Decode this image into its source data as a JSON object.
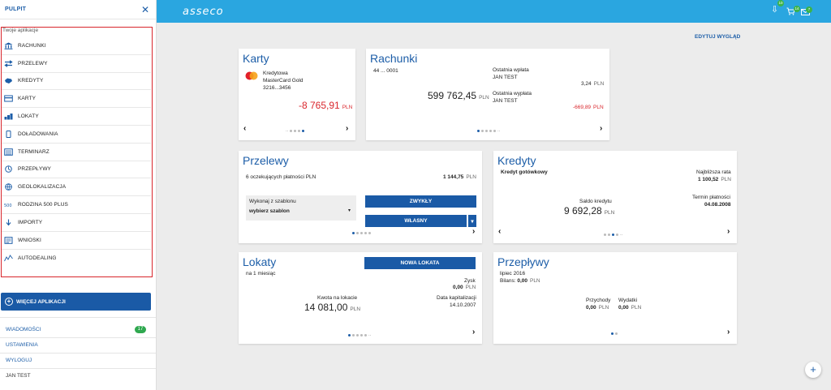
{
  "sidebar": {
    "title": "PULPIT",
    "caption": "Twoje aplikacje",
    "apps": [
      {
        "label": "RACHUNKI",
        "icon": "bank-icon"
      },
      {
        "label": "PRZELEWY",
        "icon": "transfer-icon"
      },
      {
        "label": "KREDYTY",
        "icon": "credit-icon"
      },
      {
        "label": "KARTY",
        "icon": "card-icon"
      },
      {
        "label": "LOKATY",
        "icon": "deposit-icon"
      },
      {
        "label": "DOŁADOWANIA",
        "icon": "phone-icon"
      },
      {
        "label": "TERMINARZ",
        "icon": "calendar-icon"
      },
      {
        "label": "PRZEPŁYWY",
        "icon": "flow-icon"
      },
      {
        "label": "GEOLOKALIZACJA",
        "icon": "globe-icon"
      },
      {
        "label": "RODZINA 500 PLUS",
        "icon": "family-icon"
      },
      {
        "label": "IMPORTY",
        "icon": "import-icon"
      },
      {
        "label": "WNIOSKI",
        "icon": "form-icon"
      },
      {
        "label": "AUTODEALING",
        "icon": "chart-icon"
      }
    ],
    "more_label": "WIĘCEJ APLIKACJI",
    "messages": "WIADOMOŚCI",
    "messages_count": "17",
    "settings": "USTAWIENIA",
    "logout": "WYLOGUJ",
    "user": "JAN TEST"
  },
  "topbar": {
    "logo": "asseco",
    "badge1": "10",
    "badge2": "14",
    "badge3": "7"
  },
  "edit_view": "EDYTUJ WYGLĄD",
  "karty": {
    "title": "Karty",
    "type": "Kredytowa",
    "name": "MasterCard Gold",
    "number": "3216...3456",
    "amount": "-8 765,91",
    "currency": "PLN"
  },
  "rachunki": {
    "title": "Rachunki",
    "number": "44 ... 0001",
    "balance": "599 762,45",
    "currency": "PLN",
    "last_in_label": "Ostatnia wpłata",
    "last_in_name": "JAN TEST",
    "last_in_amount": "3,24",
    "last_out_label": "Ostatnia wypłata",
    "last_out_name": "JAN TEST",
    "last_out_amount": "-669,89"
  },
  "przelewy": {
    "title": "Przelewy",
    "pending": "6 oczekujących płatności PLN",
    "pending_amount": "1 144,75",
    "currency": "PLN",
    "template_label": "Wykonaj z szablonu",
    "template_value": "wybierz szablon",
    "btn_normal": "ZWYKŁY",
    "btn_own": "WŁASNY"
  },
  "kredyty": {
    "title": "Kredyty",
    "type": "Kredyt gotówkowy",
    "next_rate_label": "Najbliższa rata",
    "next_rate": "1 100,52",
    "due_label": "Termin płatności",
    "due_date": "04.08.2008",
    "balance_label": "Saldo kredytu",
    "balance": "9 692,28",
    "currency": "PLN"
  },
  "lokaty": {
    "title": "Lokaty",
    "btn_new": "NOWA LOKATA",
    "period": "na 1 miesiąc",
    "profit_label": "Zysk",
    "profit": "0,00",
    "amount_label": "Kwota na lokacie",
    "amount": "14 081,00",
    "cap_label": "Data kapitalizacji",
    "cap_date": "14.10.2007",
    "currency": "PLN"
  },
  "przeplywy": {
    "title": "Przepływy",
    "month": "lipiec 2016",
    "balance_label": "Bilans:",
    "balance": "0,00",
    "income_label": "Przychody",
    "income": "0,00",
    "expense_label": "Wydatki",
    "expense": "0,00",
    "currency": "PLN"
  }
}
